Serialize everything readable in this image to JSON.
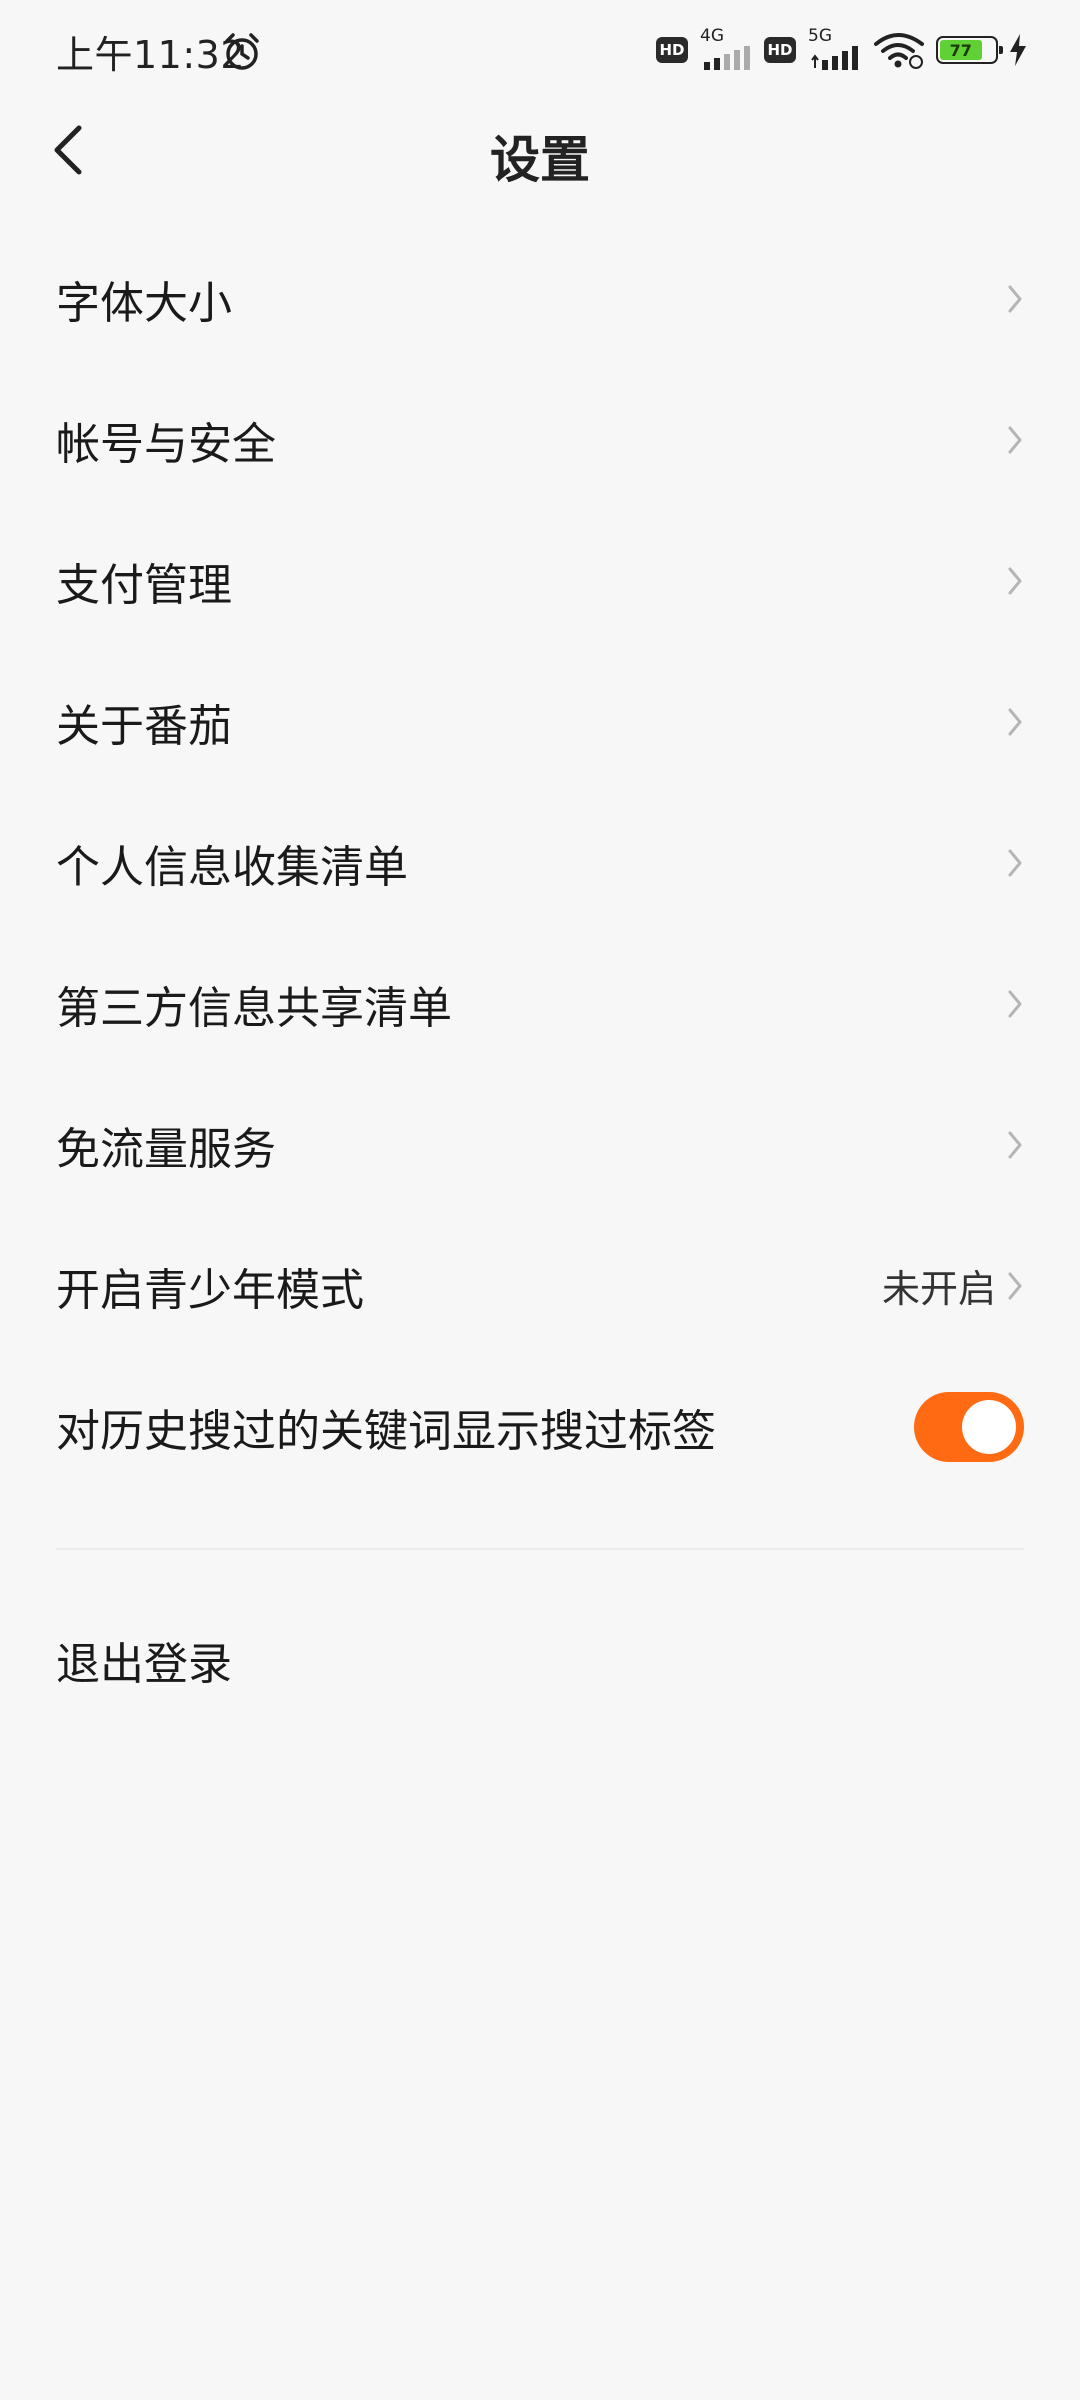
{
  "status_bar": {
    "time": "上午11:32",
    "hd1": "HD",
    "net1": "4G",
    "hd2": "HD",
    "net2": "5G",
    "battery": "77"
  },
  "header": {
    "title": "设置"
  },
  "settings": [
    {
      "label": "字体大小"
    },
    {
      "label": "帐号与安全"
    },
    {
      "label": "支付管理"
    },
    {
      "label": "关于番茄"
    },
    {
      "label": "个人信息收集清单"
    },
    {
      "label": "第三方信息共享清单"
    },
    {
      "label": "免流量服务"
    },
    {
      "label": "开启青少年模式",
      "value": "未开启"
    },
    {
      "label": "对历史搜过的关键词显示搜过标签",
      "toggle_on": true
    }
  ],
  "logout_label": "退出登录",
  "colors": {
    "accent": "#ff6a12",
    "background": "#f7f7f7",
    "battery": "#5fd135"
  }
}
